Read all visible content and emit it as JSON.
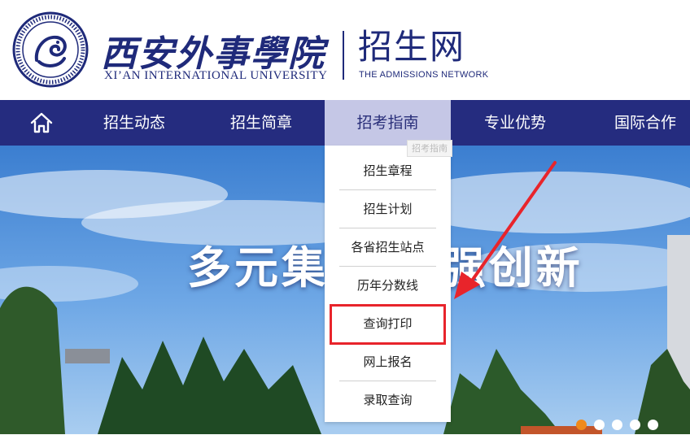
{
  "header": {
    "school_name_cn": "西安外事學院",
    "school_name_en": "XI’AN INTERNATIONAL UNIVERSITY",
    "site_title": "招生网",
    "site_subtitle": "THE ADMISSIONS NETWORK",
    "seal_icon": "university-seal-icon"
  },
  "nav": {
    "home_icon": "home-icon",
    "items": [
      {
        "label": "招生动态"
      },
      {
        "label": "招生简章"
      },
      {
        "label": "招考指南",
        "active": true
      },
      {
        "label": "专业优势"
      },
      {
        "label": "国际合作"
      }
    ],
    "tooltip": "招考指南"
  },
  "dropdown": {
    "items": [
      {
        "label": "招生章程"
      },
      {
        "label": "招生计划"
      },
      {
        "label": "各省招生站点"
      },
      {
        "label": "历年分数线"
      },
      {
        "label": "查询打印",
        "highlighted": true
      },
      {
        "label": "网上报名"
      },
      {
        "label": "录取查询"
      }
    ]
  },
  "banner": {
    "slogan": "多元集成 强强创新",
    "slide_count": 5,
    "active_slide": 1
  },
  "colors": {
    "brand_navy": "#252c7f",
    "active_tab": "#c5c7e6",
    "highlight_red": "#e8242b",
    "active_dot": "#f08a1c"
  }
}
